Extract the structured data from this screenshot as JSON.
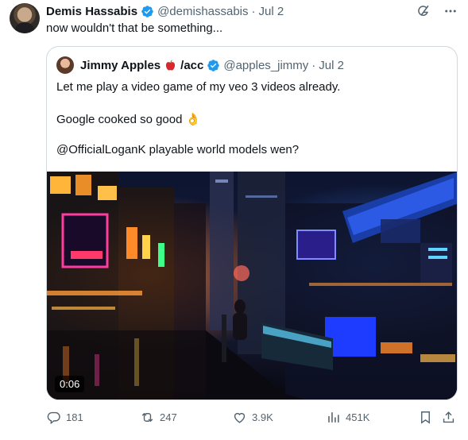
{
  "author": {
    "name": "Demis Hassabis",
    "handle": "@demishassabis",
    "separator": "·",
    "date": "Jul 2",
    "verified_color": "#1d9bf0"
  },
  "tweet_text": "now wouldn't that be something...",
  "quote": {
    "name": "Jimmy Apples",
    "name_suffix": "/acc",
    "handle": "@apples_jimmy",
    "separator": "·",
    "date": "Jul 2",
    "lines": [
      "Let me play a video game of my veo 3 videos already.",
      "Google cooked so good",
      "@OfficialLoganK  playable world models wen?"
    ],
    "emoji": "👌",
    "video": {
      "duration": "0:06"
    }
  },
  "actions": {
    "replies": "181",
    "reposts": "247",
    "likes": "3.9K",
    "views": "451K"
  },
  "icons": [
    "grok-icon",
    "more-icon",
    "reply-icon",
    "repost-icon",
    "like-icon",
    "views-icon",
    "bookmark-icon",
    "share-icon",
    "apple-icon",
    "verified-icon"
  ],
  "colors": {
    "text": "#0f1419",
    "muted": "#536471",
    "border": "#cfd9de",
    "accent": "#1d9bf0"
  }
}
